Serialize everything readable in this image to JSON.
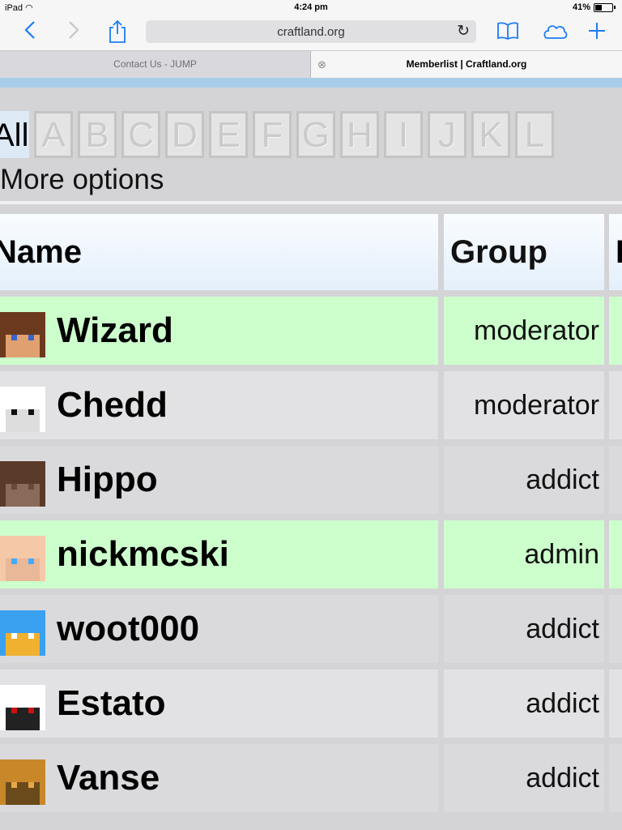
{
  "status": {
    "device": "iPad",
    "time": "4:24 pm",
    "battery": "41%",
    "battery_level": 0.41
  },
  "toolbar": {
    "url": "craftland.org"
  },
  "tabs": [
    {
      "title": "Contact Us - JUMP"
    },
    {
      "title": "Memberlist | Craftland.org"
    }
  ],
  "letters": [
    "All",
    "A",
    "B",
    "C",
    "D",
    "E",
    "F",
    "G",
    "H",
    "I",
    "J",
    "K",
    "L"
  ],
  "more_options": "More options",
  "table": {
    "headers": {
      "name": "Name",
      "group": "Group",
      "extra": "I"
    },
    "rows": [
      {
        "name": "Wizard",
        "group": "moderator",
        "highlight": true
      },
      {
        "name": "Chedd",
        "group": "moderator",
        "highlight": false
      },
      {
        "name": "Hippo",
        "group": "addict",
        "highlight": false
      },
      {
        "name": "nickmcski",
        "group": "admin",
        "highlight": true
      },
      {
        "name": "woot000",
        "group": "addict",
        "highlight": false
      },
      {
        "name": "Estato",
        "group": "addict",
        "highlight": false
      },
      {
        "name": "Vanse",
        "group": "addict",
        "highlight": false
      }
    ]
  },
  "colors": {
    "accent": "#1a7cf5",
    "highlight_row": "#ccffcc",
    "header_band": "#a9cde8"
  }
}
